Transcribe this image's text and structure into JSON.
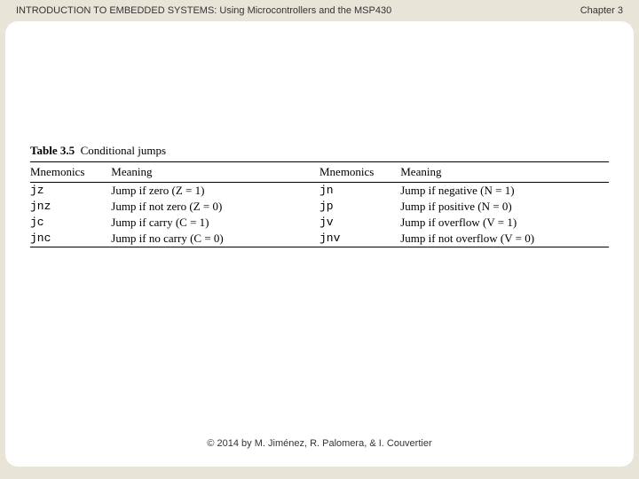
{
  "header": {
    "title": "INTRODUCTION TO EMBEDDED SYSTEMS: Using Microcontrollers and the MSP430",
    "chapter": "Chapter 3"
  },
  "table": {
    "caption_label": "Table 3.5",
    "caption_text": "Conditional jumps",
    "headers": {
      "mn1": "Mnemonics",
      "mean1": "Meaning",
      "mn2": "Mnemonics",
      "mean2": "Meaning"
    },
    "rows": [
      {
        "mn1": "jz",
        "mean1": "Jump if zero (Z = 1)",
        "mn2": "jn",
        "mean2": "Jump if negative (N = 1)"
      },
      {
        "mn1": "jnz",
        "mean1": "Jump if not zero (Z = 0)",
        "mn2": "jp",
        "mean2": "Jump if positive (N = 0)"
      },
      {
        "mn1": "jc",
        "mean1": "Jump if carry (C = 1)",
        "mn2": "jv",
        "mean2": "Jump if overflow (V = 1)"
      },
      {
        "mn1": "jnc",
        "mean1": "Jump if no carry (C = 0)",
        "mn2": "jnv",
        "mean2": "Jump if not overflow (V = 0)"
      }
    ]
  },
  "footer": {
    "copyright": "© 2014 by M. Jiménez, R. Palomera, & I. Couvertier"
  }
}
